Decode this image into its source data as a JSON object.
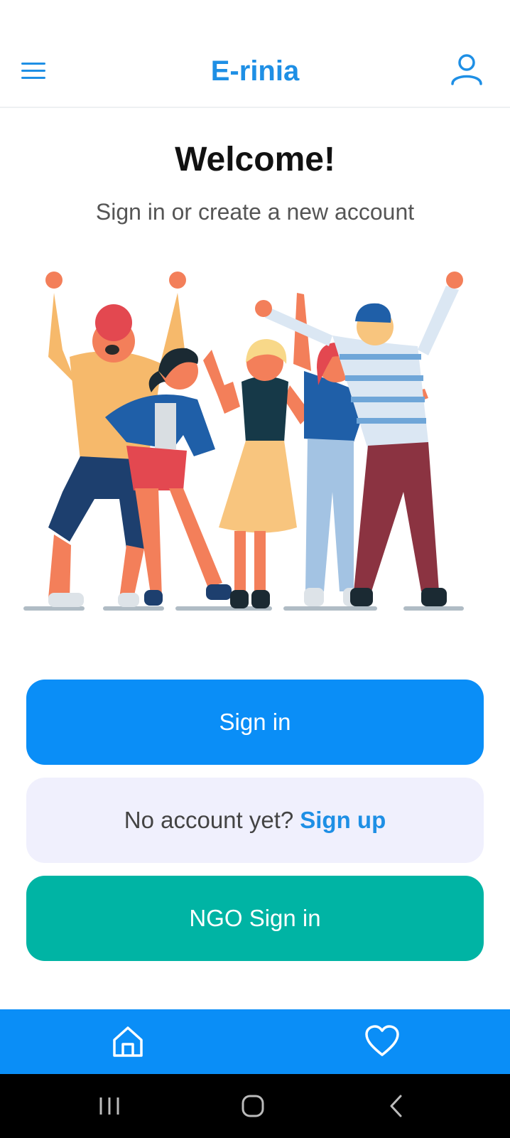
{
  "header": {
    "title": "E-rinia",
    "menu_icon": "hamburger-menu-icon",
    "account_icon": "user-account-icon",
    "accent_color": "#1e8fe5"
  },
  "hero": {
    "title": "Welcome!",
    "subtitle": "Sign in or create a new account",
    "illustration": "group-of-friends-waving-illustration"
  },
  "actions": {
    "signin_label": "Sign in",
    "signup_prompt": "No account yet?",
    "signup_link": "Sign up",
    "ngo_signin_label": "NGO Sign in"
  },
  "bottom_nav": {
    "items": [
      {
        "icon": "home-icon"
      },
      {
        "icon": "heart-icon"
      }
    ],
    "background_color": "#0a8ef7"
  },
  "system_nav": {
    "items": [
      {
        "icon": "recent-apps-icon"
      },
      {
        "icon": "home-circle-icon"
      },
      {
        "icon": "back-icon"
      }
    ]
  },
  "colors": {
    "signin_bg": "#0a8ef7",
    "signup_bg": "#f0f0fd",
    "ngo_bg": "#00b4a4"
  }
}
